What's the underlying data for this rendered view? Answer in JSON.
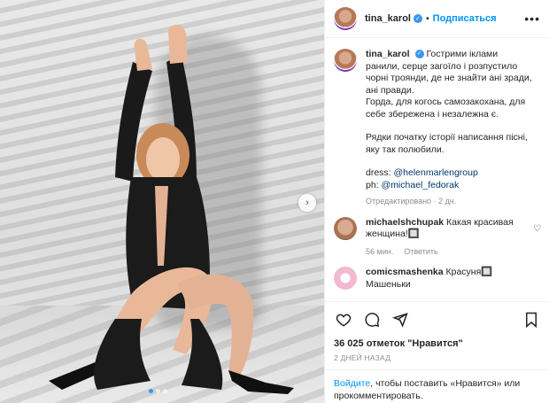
{
  "header": {
    "username": "tina_karol",
    "separator": "•",
    "follow_label": "Подписаться",
    "more_icon": "more-horizontal-icon"
  },
  "caption": {
    "username": "tina_karol",
    "line1": "Гострими іклами ранили, серце загоїло і розпустило чорні троянди, де не знайти ані зради, ані правди.",
    "line2": "Горда, для когось самозакохана, для себе збережена і незалежна є.",
    "line3": "Рядки початку історії написання пісні, яку так полюбили.",
    "dress_label": "dress:",
    "dress_mention": "@helenmarlengroup",
    "ph_label": "ph:",
    "ph_mention": "@michael_fedorak",
    "meta": "Отредактировано · 2 дн."
  },
  "comments": [
    {
      "username": "michaelshchupak",
      "text": "Какая красивая женщина!🔲",
      "time": "56 мин.",
      "reply": "Ответить"
    },
    {
      "username": "comicsmashenka",
      "text": "Красуня🔲 Машеньки"
    }
  ],
  "actions": {
    "like_icon": "heart-icon",
    "comment_icon": "comment-icon",
    "share_icon": "send-icon",
    "save_icon": "bookmark-icon"
  },
  "likes": {
    "count": "36 025",
    "text": "отметок \"Нравится\""
  },
  "timestamp": "2 ДНЕЙ НАЗАД",
  "login_prompt": {
    "link": "Войдите",
    "text": ", чтобы поставить «Нравится» или прокомментировать."
  },
  "media": {
    "next_icon": "chevron-right-icon",
    "slide_total": 3,
    "slide_active": 1
  },
  "colors": {
    "accent": "#0095f6",
    "verified": "#3897f0",
    "muted": "#8e8e8e"
  }
}
